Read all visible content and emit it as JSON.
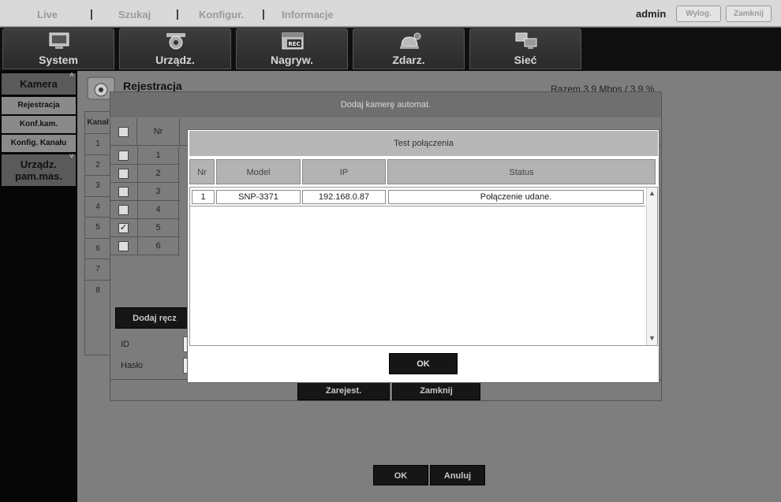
{
  "top_nav": {
    "items": [
      "Live",
      "Szukaj",
      "Konfigur.",
      "Informacje"
    ],
    "user": "admin",
    "logout_label": "Wylog.",
    "close_label": "Zamknij"
  },
  "menu": {
    "tabs": [
      "System",
      "Urządz.",
      "Nagryw.",
      "Zdarz.",
      "Sieć"
    ],
    "rec_badge": "REC"
  },
  "sidebar": {
    "section1": "Kamera",
    "items": [
      "Rejestracja",
      "Konf.kam.",
      "Konfig. Kanału"
    ],
    "section2": "Urządz. pam.mas."
  },
  "page": {
    "title": "Rejestracja",
    "rate": "Razem  3.9 Mbps / 3.9 %",
    "channel_header": "Kanał",
    "channels": [
      "1",
      "2",
      "3",
      "4",
      "5",
      "6",
      "7",
      "8"
    ],
    "ok_label": "OK",
    "cancel_label": "Anuluj"
  },
  "auto_dialog": {
    "title": "Dodaj kamerę automat.",
    "nr_header": "Nr",
    "rows": [
      {
        "nr": "1",
        "checked": false
      },
      {
        "nr": "2",
        "checked": false
      },
      {
        "nr": "3",
        "checked": false
      },
      {
        "nr": "4",
        "checked": false
      },
      {
        "nr": "5",
        "checked": true
      },
      {
        "nr": "6",
        "checked": false
      }
    ],
    "manual_add_label": "Dodaj ręcz",
    "id_label": "ID",
    "password_label": "Hasło",
    "register_label": "Zarejest.",
    "close_label": "Zamknij"
  },
  "test_dialog": {
    "title": "Test połączenia",
    "columns": [
      "Nr",
      "Model",
      "IP",
      "Status"
    ],
    "rows": [
      {
        "nr": "1",
        "model": "SNP-3371",
        "ip": "192.168.0.87",
        "status": "Połączenie udane."
      }
    ],
    "ok_label": "OK"
  }
}
